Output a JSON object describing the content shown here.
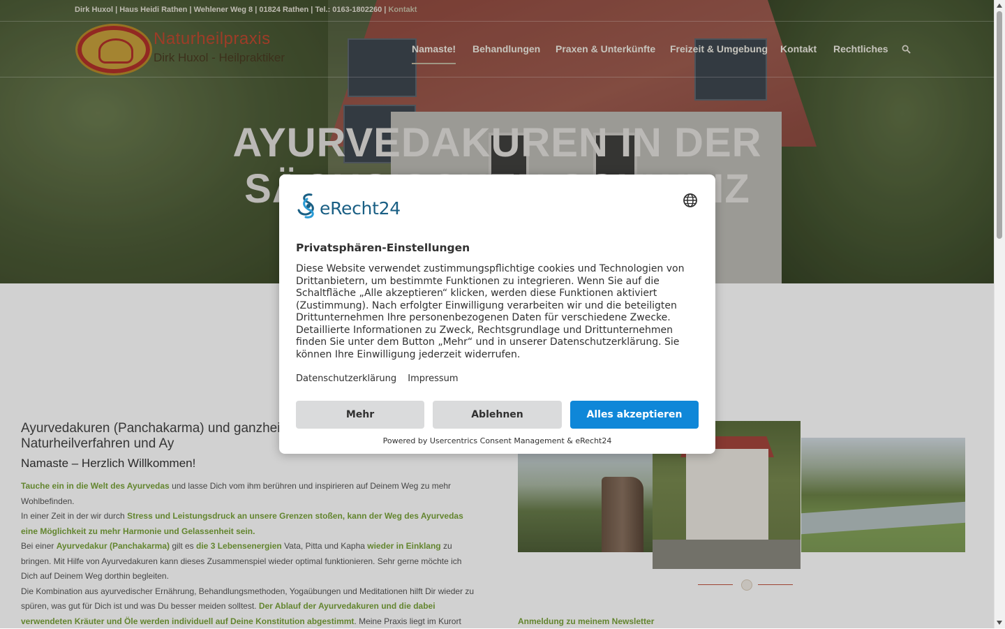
{
  "topbar": {
    "contact_line": "Dirk Huxol | Haus Heidi Rathen | Wehlener Weg 8 | 01824 Rathen | Tel.: 0163-1802260 | ",
    "contact_link": "Kontakt"
  },
  "logo": {
    "brand": "Naturheilpraxis",
    "subtitle": "Dirk Huxol - Heilpraktiker"
  },
  "nav": {
    "items": [
      {
        "label": "Namaste!",
        "active": true
      },
      {
        "label": "Behandlungen"
      },
      {
        "label": "Praxen & Unterkünfte"
      },
      {
        "label": "Freizeit & Umgebung"
      },
      {
        "label": "Kontakt"
      },
      {
        "label": "Rechtliches"
      }
    ],
    "search_icon": "search-icon"
  },
  "hero": {
    "title": "Ayurvedakuren in der Sächsischen Schweiz"
  },
  "intro": {
    "heading": "Ayurvedakuren (Panchakarma) und ganzhei Heilpraktiker für Naturheilverfahren und Ay",
    "subheading": "Namaste – Herzlich Willkommen!",
    "p1_a": "Tauche ein in die Welt des Ayurvedas",
    "p1_b": " und lasse Dich vom ihm berühren und inspirieren auf Deinem Weg zu mehr Wohlbefinden.",
    "p2_a": "In einer Zeit in der wir durch ",
    "p2_b": "Stress und Leistungsdruck an unsere Grenzen stoßen, kann der Weg des Ayurvedas eine Möglichkeit zu mehr Harmonie und Gelassenheit sein.",
    "p3_a": "Bei einer ",
    "p3_b": "Ayurvedakur (Panchakarma)",
    "p3_c": " gilt es ",
    "p3_d": "die 3 Lebensenergien",
    "p3_e": " Vata, Pitta und Kapha ",
    "p3_f": "wieder in Einklang",
    "p3_g": " zu bringen. Mit Hilfe von Ayurvedakuren kann dieses Zusammenspiel wieder optimal funktionieren. Sehr gerne möchte ich Dich auf Deinem Weg dorthin begleiten.",
    "p4_a": "Die Kombination aus ayurvedischer Ernährung, Behandlungsmethoden, Yogaübungen und Meditationen hilft Dir wieder zu spüren, was gut für Dich ist und was Du besser meiden solltest. ",
    "p4_b": "Der Ablauf der Ayurvedakuren und die dabei verwendeten Kräuter und Öle werden individuell auf Deine Konstitution abgestimmt",
    "p4_c": ". Meine Praxis liegt im Kurort"
  },
  "newsletter": {
    "label": "Anmeldung zu meinem Newsletter"
  },
  "consent": {
    "brand": "eRecht24",
    "title": "Privatsphären-Einstellungen",
    "description": "Diese Website verwendet zustimmungspflichtige cookies und Technologien von Drittanbietern, um bestimmte Funktionen zu integrieren. Wenn Sie auf die Schaltfläche „Alle akzeptieren“ klicken, werden diese Funktionen aktiviert (Zustimmung). Nach erfolgter Einwilligung verarbeiten wir und die beteiligten Drittunternehmen Ihre personenbezogenen Daten für verschiedene Zwecke. Detaillierte Informationen zu Zweck, Rechtsgrundlage und Drittunternehmen finden Sie unter dem Button „Mehr“ und in unserer Datenschutzerklärung. Sie können Ihre Einwilligung jederzeit widerrufen.",
    "link_privacy": "Datenschutzerklärung",
    "link_imprint": "Impressum",
    "btn_more": "Mehr",
    "btn_decline": "Ablehnen",
    "btn_accept": "Alles akzeptieren",
    "powered_by": "Powered by Usercentrics Consent Management & eRecht24",
    "accept_color": "#0f87d8"
  },
  "colors": {
    "accent_green": "#79a33a",
    "brand_red": "#c04a30"
  }
}
